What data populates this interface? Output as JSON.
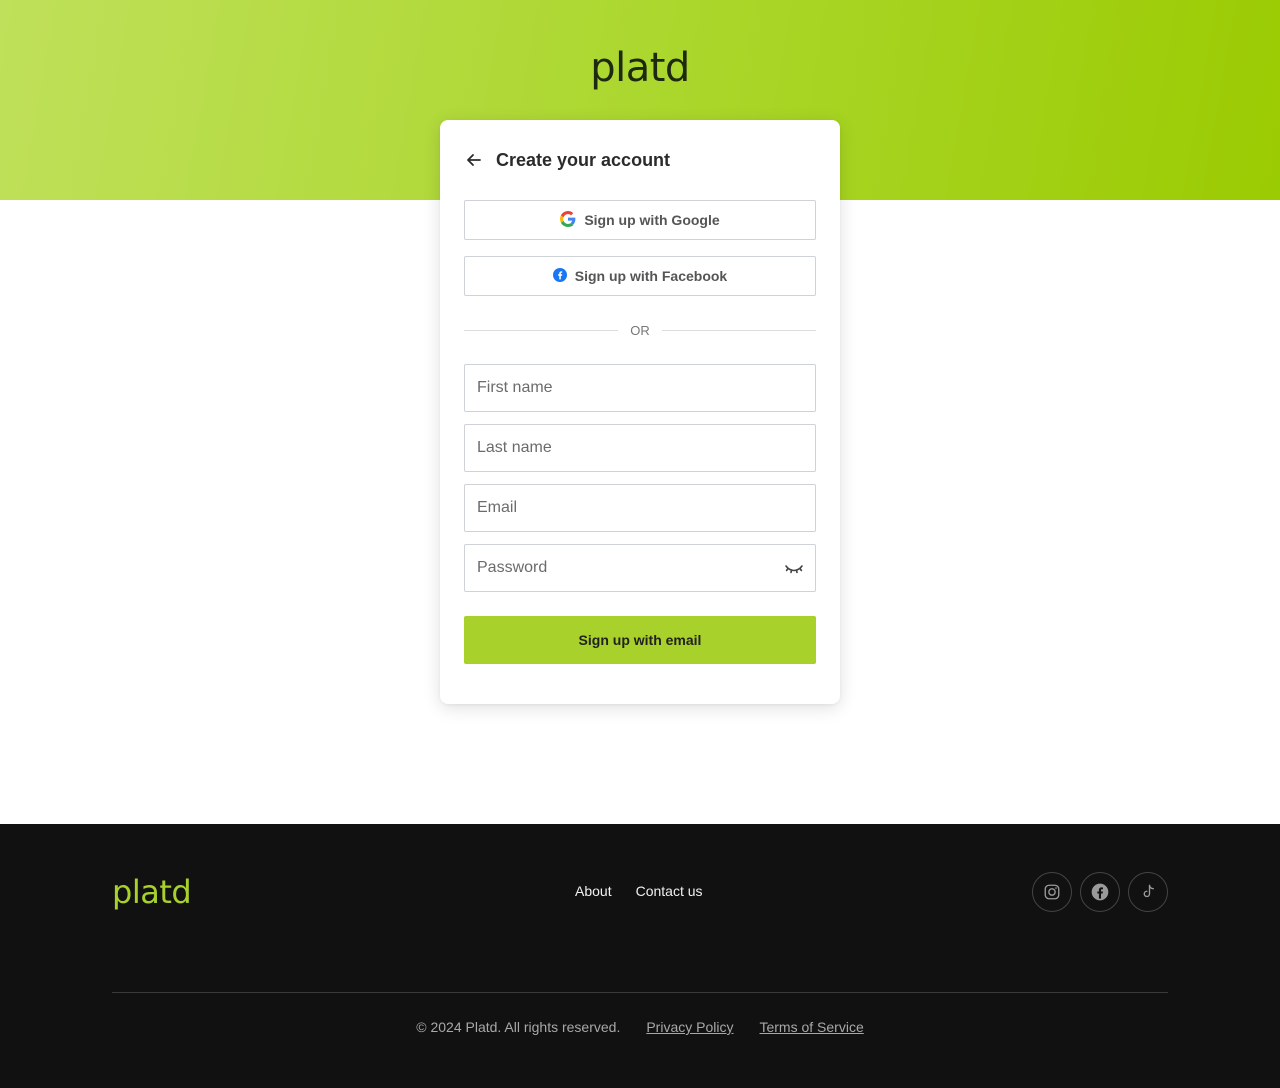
{
  "brand": {
    "name": "platd",
    "accent": "#a8d12b",
    "footer_bg": "#111111"
  },
  "signup_card": {
    "title": "Create your account",
    "back_icon": "arrow-left-icon",
    "google_label": "Sign up with Google",
    "facebook_label": "Sign up with Facebook",
    "divider": "OR",
    "first_name_placeholder": "First name",
    "last_name_placeholder": "Last name",
    "email_placeholder": "Email",
    "password_placeholder": "Password",
    "password_toggle_icon": "eye-closed-icon",
    "submit_label": "Sign up with email"
  },
  "footer": {
    "nav": [
      {
        "label": "About"
      },
      {
        "label": "Contact us"
      }
    ],
    "socials": [
      {
        "icon": "instagram-icon"
      },
      {
        "icon": "facebook-icon"
      },
      {
        "icon": "tiktok-icon"
      }
    ],
    "copyright": "© 2024 Platd. All rights reserved.",
    "privacy": "Privacy Policy",
    "terms": "Terms of Service"
  }
}
